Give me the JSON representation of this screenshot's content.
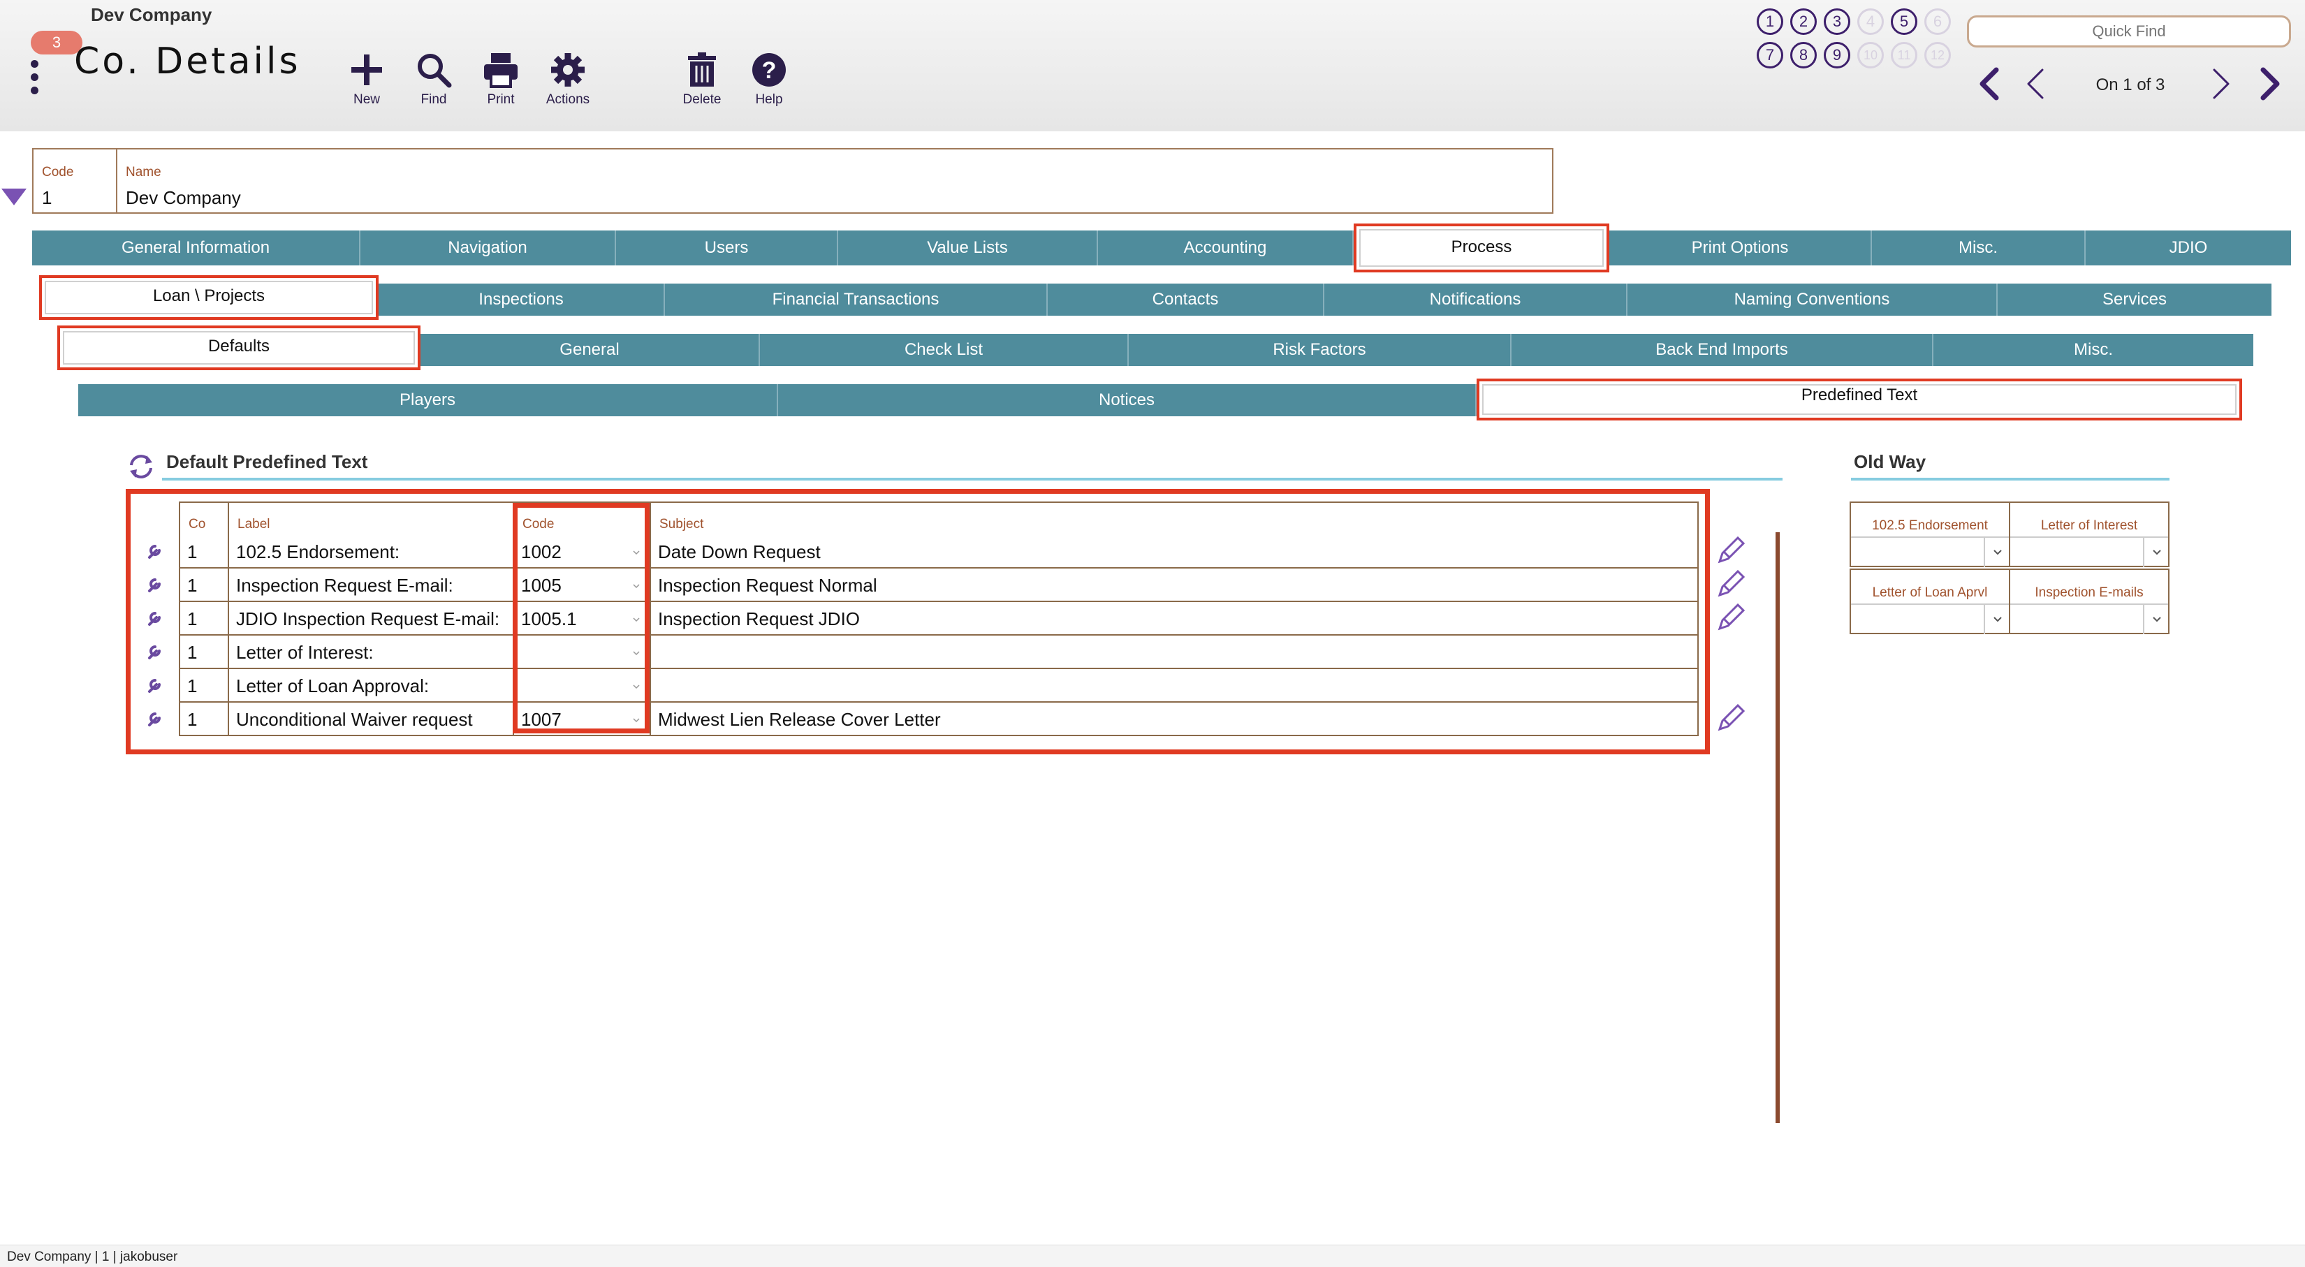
{
  "header": {
    "company_name": "Dev Company",
    "badge_count": "3",
    "page_title": "Co. Details",
    "toolbar": [
      {
        "name": "new",
        "label": "New"
      },
      {
        "name": "find",
        "label": "Find"
      },
      {
        "name": "print",
        "label": "Print"
      },
      {
        "name": "actions",
        "label": "Actions"
      },
      {
        "name": "delete",
        "label": "Delete"
      },
      {
        "name": "help",
        "label": "Help"
      }
    ],
    "favorites": [
      "1",
      "2",
      "3",
      "4",
      "5",
      "6",
      "7",
      "8",
      "9",
      "10",
      "11",
      "12"
    ],
    "quick_find_placeholder": "Quick Find",
    "record_status": "On 1 of 3"
  },
  "record": {
    "code_label": "Code",
    "code_value": "1",
    "name_label": "Name",
    "name_value": "Dev Company"
  },
  "tabs": {
    "main": [
      "General Information",
      "Navigation",
      "Users",
      "Value Lists",
      "Accounting",
      "Process",
      "Print Options",
      "Misc.",
      "JDIO"
    ],
    "process": [
      "Loan \\ Projects",
      "Inspections",
      "Financial Transactions",
      "Contacts",
      "Notifications",
      "Naming Conventions",
      "Services"
    ],
    "loan_projects": [
      "Defaults",
      "General",
      "Check List",
      "Risk Factors",
      "Back End Imports",
      "Misc."
    ],
    "defaults": [
      "Players",
      "Notices",
      "Predefined Text"
    ]
  },
  "predefined": {
    "title": "Default Predefined Text",
    "headers": {
      "co": "Co",
      "label": "Label",
      "code": "Code",
      "subject": "Subject"
    },
    "rows": [
      {
        "co": "1",
        "label": "102.5 Endorsement:",
        "code": "1002",
        "subject": "Date Down Request"
      },
      {
        "co": "1",
        "label": "Inspection Request E-mail:",
        "code": "1005",
        "subject": "Inspection Request Normal"
      },
      {
        "co": "1",
        "label": "JDIO Inspection Request E-mail:",
        "code": "1005.1",
        "subject": "Inspection Request JDIO"
      },
      {
        "co": "1",
        "label": "Letter of Interest:",
        "code": "",
        "subject": ""
      },
      {
        "co": "1",
        "label": "Letter of Loan Approval:",
        "code": "",
        "subject": ""
      },
      {
        "co": "1",
        "label": "Unconditional Waiver request",
        "code": "1007",
        "subject": "Midwest Lien Release Cover Letter"
      }
    ]
  },
  "old_way": {
    "title": "Old Way",
    "fields": [
      "102.5 Endorsement",
      "Letter of Interest",
      "Letter of Loan Aprvl",
      "Inspection E-mails"
    ]
  },
  "footer": {
    "status": "Dev Company | 1 | jakobuser"
  },
  "colors": {
    "accent": "#3d1f6b",
    "tab_bar": "#4f8c9c",
    "highlight": "#e03a22",
    "label": "#a0522d"
  }
}
